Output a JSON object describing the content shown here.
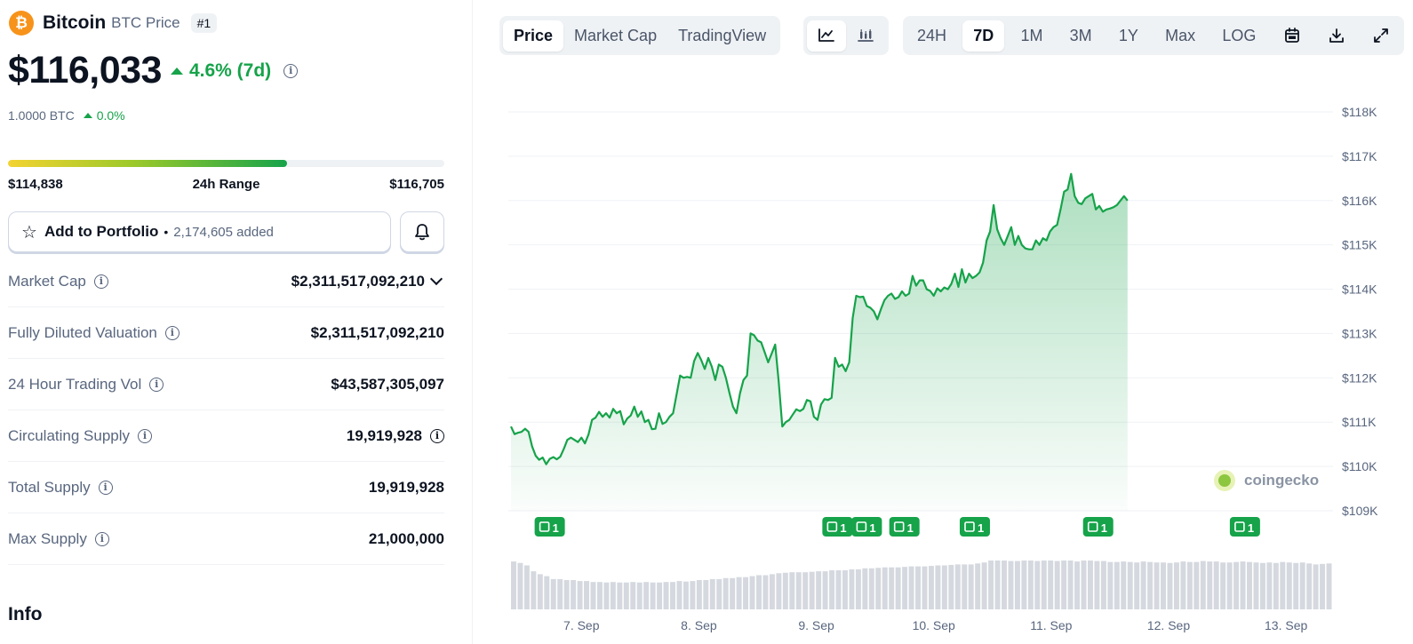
{
  "coin": {
    "name": "Bitcoin",
    "subtitle": "BTC Price",
    "rank": "#1",
    "logo_symbol": "₿",
    "logo_color": "#f7931a",
    "price": "$116,033",
    "change_7d": "4.6% (7d)",
    "btc_value": "1.0000 BTC",
    "btc_change": "0.0%"
  },
  "range": {
    "low": "$114,838",
    "label": "24h Range",
    "high": "$116,705",
    "position_pct": 64
  },
  "portfolio": {
    "label": "Add to Portfolio",
    "separator": "•",
    "count": "2,174,605 added"
  },
  "stats": [
    {
      "label": "Market Cap",
      "value": "$2,311,517,092,210",
      "expandable": true,
      "value_info": false
    },
    {
      "label": "Fully Diluted Valuation",
      "value": "$2,311,517,092,210",
      "expandable": false,
      "value_info": false
    },
    {
      "label": "24 Hour Trading Vol",
      "value": "$43,587,305,097",
      "expandable": false,
      "value_info": false
    },
    {
      "label": "Circulating Supply",
      "value": "19,919,928",
      "expandable": false,
      "value_info": true
    },
    {
      "label": "Total Supply",
      "value": "19,919,928",
      "expandable": false,
      "value_info": false
    },
    {
      "label": "Max Supply",
      "value": "21,000,000",
      "expandable": false,
      "value_info": false
    }
  ],
  "info_heading": "Info",
  "toolbar": {
    "view_tabs": [
      "Price",
      "Market Cap",
      "TradingView"
    ],
    "active_view": "Price",
    "chart_types": [
      "line-chart-icon",
      "candlestick-icon"
    ],
    "active_chart_type": "line-chart-icon",
    "ranges": [
      "24H",
      "7D",
      "1M",
      "3M",
      "1Y",
      "Max",
      "LOG"
    ],
    "active_range": "7D",
    "extra_icons": [
      "calendar-icon",
      "download-icon",
      "fullscreen-icon"
    ]
  },
  "colors": {
    "up": "#16a34a",
    "line": "#16a34a",
    "volume": "#d5d9df"
  },
  "watermark": "coingecko",
  "chart_data": {
    "type": "area",
    "y_ticks": [
      "$118K",
      "$117K",
      "$116K",
      "$115K",
      "$114K",
      "$113K",
      "$112K",
      "$111K",
      "$110K",
      "$109K"
    ],
    "ylim": [
      109000,
      118000
    ],
    "x_ticks": [
      "7. Sep",
      "8. Sep",
      "9. Sep",
      "10. Sep",
      "11. Sep",
      "12. Sep",
      "13. Sep"
    ],
    "x_tick_days": [
      6.6,
      7.6,
      8.6,
      9.6,
      10.6,
      11.6,
      12.6
    ],
    "xlim": [
      6.0,
      13.0
    ],
    "series": [
      {
        "values": [
          [
            6.0,
            110900
          ],
          [
            6.03,
            110730
          ],
          [
            6.06,
            110760
          ],
          [
            6.09,
            110780
          ],
          [
            6.12,
            110850
          ],
          [
            6.15,
            110780
          ],
          [
            6.18,
            110450
          ],
          [
            6.21,
            110240
          ],
          [
            6.24,
            110150
          ],
          [
            6.27,
            110200
          ],
          [
            6.3,
            110050
          ],
          [
            6.33,
            110170
          ],
          [
            6.36,
            110210
          ],
          [
            6.39,
            110160
          ],
          [
            6.42,
            110220
          ],
          [
            6.45,
            110400
          ],
          [
            6.48,
            110600
          ],
          [
            6.51,
            110650
          ],
          [
            6.54,
            110600
          ],
          [
            6.57,
            110550
          ],
          [
            6.6,
            110650
          ],
          [
            6.63,
            110520
          ],
          [
            6.66,
            110720
          ],
          [
            6.69,
            111050
          ],
          [
            6.72,
            111100
          ],
          [
            6.75,
            111230
          ],
          [
            6.78,
            111120
          ],
          [
            6.81,
            111200
          ],
          [
            6.84,
            111100
          ],
          [
            6.87,
            111300
          ],
          [
            6.9,
            111200
          ],
          [
            6.93,
            111250
          ],
          [
            6.96,
            110950
          ],
          [
            6.99,
            111080
          ],
          [
            7.02,
            111150
          ],
          [
            7.05,
            111350
          ],
          [
            7.08,
            111120
          ],
          [
            7.11,
            111240
          ],
          [
            7.14,
            111000
          ],
          [
            7.17,
            111050
          ],
          [
            7.2,
            110840
          ],
          [
            7.23,
            110850
          ],
          [
            7.26,
            111200
          ],
          [
            7.29,
            110960
          ],
          [
            7.32,
            111000
          ],
          [
            7.35,
            111120
          ],
          [
            7.38,
            111200
          ],
          [
            7.41,
            111620
          ],
          [
            7.44,
            112050
          ],
          [
            7.47,
            112000
          ],
          [
            7.5,
            112020
          ],
          [
            7.53,
            112000
          ],
          [
            7.56,
            112380
          ],
          [
            7.59,
            112560
          ],
          [
            7.62,
            112400
          ],
          [
            7.65,
            112200
          ],
          [
            7.68,
            112450
          ],
          [
            7.71,
            112250
          ],
          [
            7.74,
            111950
          ],
          [
            7.77,
            112300
          ],
          [
            7.8,
            112250
          ],
          [
            7.83,
            112000
          ],
          [
            7.86,
            111660
          ],
          [
            7.89,
            111350
          ],
          [
            7.92,
            111200
          ],
          [
            7.95,
            111650
          ],
          [
            7.98,
            111950
          ],
          [
            8.01,
            112050
          ],
          [
            8.04,
            113000
          ],
          [
            8.07,
            112960
          ],
          [
            8.1,
            112840
          ],
          [
            8.13,
            112800
          ],
          [
            8.16,
            112580
          ],
          [
            8.19,
            112350
          ],
          [
            8.22,
            112550
          ],
          [
            8.25,
            112750
          ],
          [
            8.28,
            111900
          ],
          [
            8.31,
            110900
          ],
          [
            8.34,
            111000
          ],
          [
            8.37,
            111050
          ],
          [
            8.4,
            111170
          ],
          [
            8.43,
            111290
          ],
          [
            8.46,
            111250
          ],
          [
            8.49,
            111300
          ],
          [
            8.52,
            111500
          ],
          [
            8.55,
            111470
          ],
          [
            8.58,
            111120
          ],
          [
            8.61,
            111050
          ],
          [
            8.64,
            111400
          ],
          [
            8.67,
            111520
          ],
          [
            8.7,
            111500
          ],
          [
            8.73,
            111550
          ],
          [
            8.76,
            112450
          ],
          [
            8.79,
            112250
          ],
          [
            8.82,
            112300
          ],
          [
            8.85,
            112150
          ],
          [
            8.88,
            112350
          ],
          [
            8.91,
            113350
          ],
          [
            8.94,
            113850
          ],
          [
            8.97,
            113820
          ],
          [
            9.0,
            113830
          ],
          [
            9.03,
            113620
          ],
          [
            9.06,
            113580
          ],
          [
            9.09,
            113500
          ],
          [
            9.12,
            113320
          ],
          [
            9.15,
            113550
          ],
          [
            9.18,
            113750
          ],
          [
            9.21,
            113850
          ],
          [
            9.24,
            113900
          ],
          [
            9.27,
            113780
          ],
          [
            9.3,
            113820
          ],
          [
            9.33,
            113950
          ],
          [
            9.36,
            113850
          ],
          [
            9.39,
            113900
          ],
          [
            9.42,
            114300
          ],
          [
            9.45,
            114080
          ],
          [
            9.48,
            114200
          ],
          [
            9.51,
            114200
          ],
          [
            9.54,
            114000
          ],
          [
            9.57,
            113960
          ],
          [
            9.6,
            113850
          ],
          [
            9.63,
            114020
          ],
          [
            9.66,
            113950
          ],
          [
            9.69,
            114040
          ],
          [
            9.72,
            114000
          ],
          [
            9.75,
            114120
          ],
          [
            9.78,
            114350
          ],
          [
            9.81,
            114050
          ],
          [
            9.84,
            114450
          ],
          [
            9.87,
            114150
          ],
          [
            9.9,
            114350
          ],
          [
            9.93,
            114250
          ],
          [
            9.96,
            114300
          ],
          [
            9.99,
            114380
          ],
          [
            10.02,
            114600
          ],
          [
            10.05,
            115100
          ],
          [
            10.08,
            115300
          ],
          [
            10.11,
            115900
          ],
          [
            10.14,
            115350
          ],
          [
            10.17,
            115150
          ],
          [
            10.2,
            115000
          ],
          [
            10.23,
            115200
          ],
          [
            10.26,
            115400
          ],
          [
            10.29,
            115000
          ],
          [
            10.32,
            115200
          ],
          [
            10.35,
            115000
          ],
          [
            10.38,
            114920
          ],
          [
            10.41,
            114900
          ],
          [
            10.44,
            114900
          ],
          [
            10.47,
            115100
          ],
          [
            10.5,
            115000
          ],
          [
            10.53,
            115150
          ],
          [
            10.56,
            115100
          ],
          [
            10.59,
            115300
          ],
          [
            10.62,
            115400
          ],
          [
            10.65,
            115450
          ],
          [
            10.68,
            115800
          ],
          [
            10.71,
            116200
          ],
          [
            10.74,
            116250
          ],
          [
            10.77,
            116600
          ],
          [
            10.8,
            116100
          ],
          [
            10.83,
            115950
          ],
          [
            10.86,
            115920
          ],
          [
            10.89,
            116050
          ],
          [
            10.92,
            116100
          ],
          [
            10.95,
            116150
          ],
          [
            10.98,
            115800
          ],
          [
            11.01,
            115880
          ],
          [
            11.04,
            115750
          ],
          [
            11.07,
            115800
          ],
          [
            11.1,
            115820
          ],
          [
            11.13,
            115850
          ],
          [
            11.16,
            115900
          ],
          [
            11.19,
            116000
          ],
          [
            11.22,
            116100
          ],
          [
            11.25,
            116000
          ]
        ]
      }
    ],
    "news_markers": [
      {
        "day": 6.33,
        "label": "1"
      },
      {
        "day": 8.78,
        "label": "1"
      },
      {
        "day": 9.03,
        "label": "1"
      },
      {
        "day": 9.35,
        "label": "1"
      },
      {
        "day": 9.95,
        "label": "1"
      },
      {
        "day": 11.0,
        "label": "1"
      },
      {
        "day": 12.25,
        "label": "1"
      }
    ],
    "volume_profile": [
      0.98,
      0.95,
      0.9,
      0.78,
      0.72,
      0.68,
      0.62,
      0.62,
      0.6,
      0.6,
      0.58,
      0.58,
      0.56,
      0.56,
      0.55,
      0.56,
      0.55,
      0.55,
      0.56,
      0.55,
      0.56,
      0.55,
      0.55,
      0.56,
      0.56,
      0.58,
      0.57,
      0.58,
      0.6,
      0.6,
      0.62,
      0.62,
      0.64,
      0.64,
      0.66,
      0.66,
      0.68,
      0.7,
      0.7,
      0.72,
      0.74,
      0.75,
      0.76,
      0.76,
      0.76,
      0.77,
      0.78,
      0.78,
      0.8,
      0.8,
      0.8,
      0.82,
      0.82,
      0.84,
      0.84,
      0.85,
      0.86,
      0.86,
      0.86,
      0.87,
      0.88,
      0.88,
      0.88,
      0.89,
      0.9,
      0.9,
      0.91,
      0.92,
      0.92,
      0.92,
      0.94,
      0.96,
      1.0,
      1.0,
      1.0,
      0.99,
      0.99,
      1.0,
      1.0,
      0.99,
      1.0,
      1.0,
      0.99,
      1.0,
      1.0,
      0.98,
      1.0,
      1.0,
      0.99,
      0.99,
      0.97,
      0.97,
      0.98,
      0.97,
      0.96,
      0.98,
      0.97,
      0.96,
      0.96,
      0.95,
      0.96,
      0.98,
      0.97,
      0.97,
      0.99,
      0.98,
      0.98,
      0.96,
      0.96,
      0.97,
      0.98,
      0.97,
      0.96,
      0.95,
      0.96,
      0.95,
      0.97,
      0.96,
      0.95,
      0.96,
      0.94,
      0.92,
      0.93,
      0.94
    ]
  }
}
